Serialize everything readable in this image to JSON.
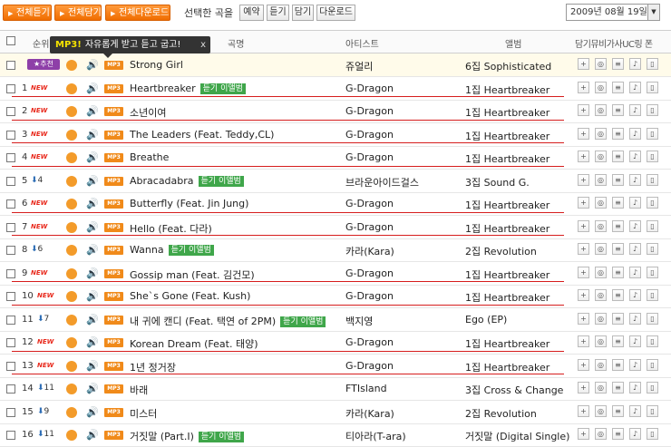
{
  "toolbar": {
    "buttons": [
      "전체듣기",
      "전체담기",
      "전체다운로드"
    ],
    "selected_label": "선택한 곡을",
    "action_buttons": [
      "예약",
      "듣기",
      "담기",
      "다운로드"
    ],
    "date": "2009년 08월 19일"
  },
  "header": {
    "rank": "순위",
    "song": "곡명",
    "artist": "아티스트",
    "album": "앨범",
    "actions": "담기뮤비가사UC링 폰"
  },
  "tooltip": {
    "badge": "MP3!",
    "text": "자유롭게 받고 듣고 굽고!",
    "close": "x"
  },
  "featured_label": "추천",
  "album_badge_label": "듣기 이앨범",
  "new_label": "NEW",
  "action_icons": [
    "+",
    "◎",
    "≡",
    "♪",
    "▯"
  ],
  "rows": [
    {
      "rank": "",
      "featured": true,
      "change": "",
      "title": "Strong Girl",
      "badge": false,
      "artist": "쥬얼리",
      "album": "6집 Sophisticated"
    },
    {
      "rank": "1",
      "new": true,
      "change": "",
      "title": "Heartbreaker",
      "badge": true,
      "artist": "G-Dragon",
      "album": "1집 Heartbreaker"
    },
    {
      "rank": "2",
      "new": true,
      "change": "",
      "title": "소년이여",
      "badge": false,
      "artist": "G-Dragon",
      "album": "1집 Heartbreaker"
    },
    {
      "rank": "3",
      "new": true,
      "change": "",
      "title": "The Leaders (Feat. Teddy,CL)",
      "badge": false,
      "artist": "G-Dragon",
      "album": "1집 Heartbreaker"
    },
    {
      "rank": "4",
      "new": true,
      "change": "",
      "title": "Breathe",
      "badge": false,
      "artist": "G-Dragon",
      "album": "1집 Heartbreaker"
    },
    {
      "rank": "5",
      "new": false,
      "change": "4",
      "title": "Abracadabra",
      "badge": true,
      "artist": "브라운아이드걸스",
      "album": "3집 Sound G."
    },
    {
      "rank": "6",
      "new": true,
      "change": "",
      "title": "Butterfly (Feat. Jin Jung)",
      "badge": false,
      "artist": "G-Dragon",
      "album": "1집 Heartbreaker"
    },
    {
      "rank": "7",
      "new": true,
      "change": "",
      "title": "Hello (Feat. 다라)",
      "badge": false,
      "artist": "G-Dragon",
      "album": "1집 Heartbreaker"
    },
    {
      "rank": "8",
      "new": false,
      "change": "6",
      "title": "Wanna",
      "badge": true,
      "artist": "카라(Kara)",
      "album": "2집 Revolution"
    },
    {
      "rank": "9",
      "new": true,
      "change": "",
      "title": "Gossip man (Feat. 김건모)",
      "badge": false,
      "artist": "G-Dragon",
      "album": "1집 Heartbreaker"
    },
    {
      "rank": "10",
      "new": true,
      "change": "",
      "title": "She`s Gone (Feat. Kush)",
      "badge": false,
      "artist": "G-Dragon",
      "album": "1집 Heartbreaker"
    },
    {
      "rank": "11",
      "new": false,
      "change": "7",
      "title": "내 귀에 캔디 (Feat. 택연 of 2PM)",
      "badge": true,
      "artist": "백지영",
      "album": "Ego (EP)"
    },
    {
      "rank": "12",
      "new": true,
      "change": "",
      "title": "Korean Dream (Feat. 태양)",
      "badge": false,
      "artist": "G-Dragon",
      "album": "1집 Heartbreaker"
    },
    {
      "rank": "13",
      "new": true,
      "change": "",
      "title": "1년 정거장",
      "badge": false,
      "artist": "G-Dragon",
      "album": "1집 Heartbreaker"
    },
    {
      "rank": "14",
      "new": false,
      "change": "11",
      "title": "바래",
      "badge": false,
      "artist": "FTIsland",
      "album": "3집 Cross & Change"
    },
    {
      "rank": "15",
      "new": false,
      "change": "9",
      "title": "미스터",
      "badge": false,
      "artist": "카라(Kara)",
      "album": "2집 Revolution"
    },
    {
      "rank": "16",
      "new": false,
      "change": "11",
      "title": "거짓말 (Part.I)",
      "badge": true,
      "artist": "티아라(T-ara)",
      "album": "거짓말 (Digital Single)"
    }
  ],
  "colors": {
    "accent": "#f07a10",
    "new": "#e8291c",
    "down": "#2d6db5",
    "underline": "#d61d1d",
    "badge": "#3fa64a"
  }
}
